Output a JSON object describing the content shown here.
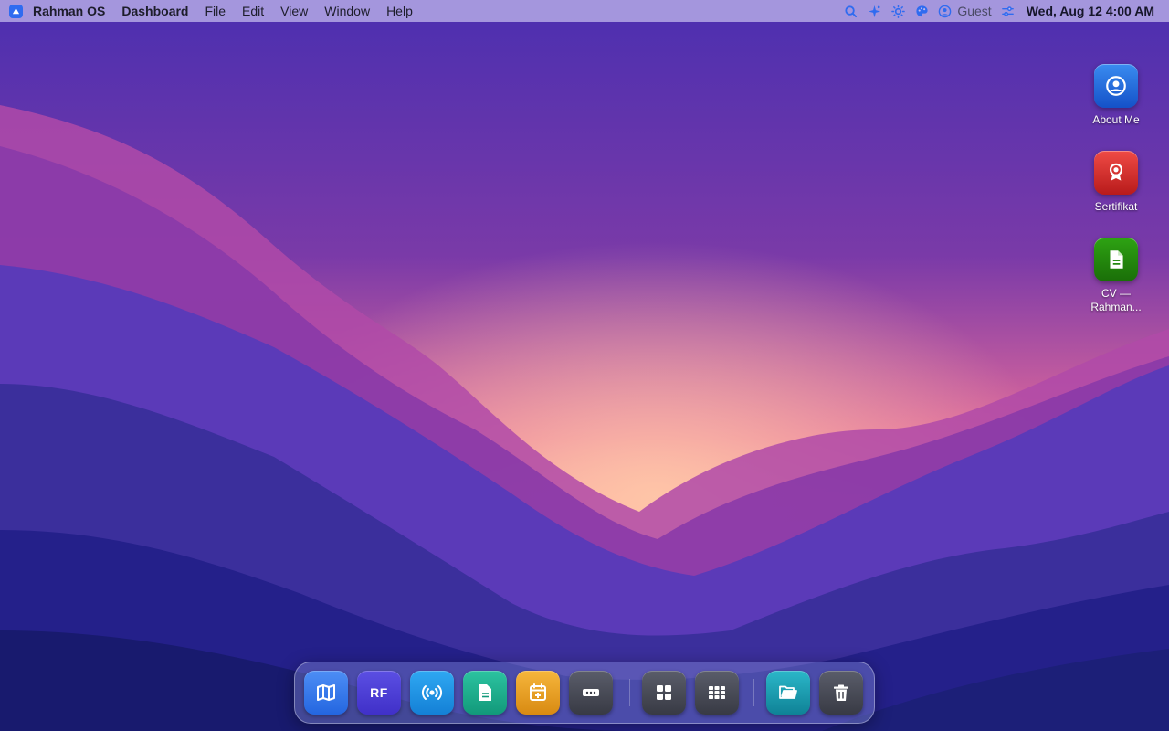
{
  "menubar": {
    "app_name": "Rahman OS",
    "items": [
      "Dashboard",
      "File",
      "Edit",
      "View",
      "Window",
      "Help"
    ],
    "status_icons": [
      "search-icon",
      "sparkle-icon",
      "brightness-icon",
      "palette-icon",
      "user-icon",
      "sliders-icon"
    ],
    "user": "Guest",
    "clock": "Wed, Aug 12 4:00 AM"
  },
  "desktop_icons": [
    {
      "label": "About Me",
      "icon": "user-circle-icon",
      "color": "#2f74e6"
    },
    {
      "label": "Sertifikat",
      "icon": "award-icon",
      "color": "#d63333"
    },
    {
      "label": "CV — Rahman...",
      "icon": "document-icon",
      "color": "#24880f"
    }
  ],
  "dock": {
    "items": [
      {
        "icon": "map-icon"
      },
      {
        "icon": "rf-logo-icon",
        "label": "RF"
      },
      {
        "icon": "radio-broadcast-icon"
      },
      {
        "icon": "document-icon"
      },
      {
        "icon": "calendar-add-icon"
      },
      {
        "icon": "more-icon"
      },
      {
        "icon": "grid-2x2-icon"
      },
      {
        "icon": "grid-3x3-icon"
      },
      {
        "icon": "folder-open-icon"
      },
      {
        "icon": "trash-icon"
      }
    ]
  },
  "colors": {
    "menubar": "#c6beee",
    "accent": "#2f6bf0"
  }
}
